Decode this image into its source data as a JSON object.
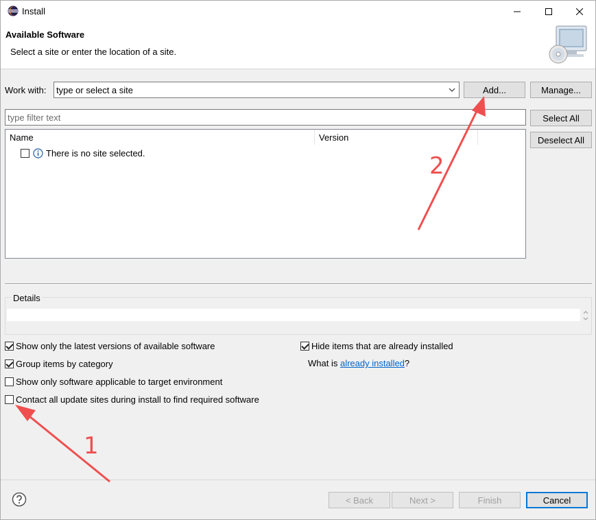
{
  "window": {
    "title": "Install",
    "controls": {
      "minimize_icon": "minimize-icon",
      "maximize_icon": "maximize-icon",
      "close_icon": "close-icon"
    }
  },
  "banner": {
    "title": "Available Software",
    "subtitle": "Select a site or enter the location of a site.",
    "icon": "computer-cd-icon"
  },
  "work_with": {
    "label": "Work with:",
    "value": "type or select a site",
    "add_label": "Add...",
    "manage_label": "Manage..."
  },
  "filter": {
    "placeholder": "type filter text",
    "select_all_label": "Select All",
    "deselect_all_label": "Deselect All"
  },
  "table": {
    "columns": [
      "Name",
      "Version"
    ],
    "rows": [
      {
        "checked": false,
        "icon": "info-icon",
        "text": "There is no site selected."
      }
    ]
  },
  "details": {
    "label": "Details"
  },
  "options": {
    "show_latest": {
      "label": "Show only the latest versions of available software",
      "checked": true
    },
    "group_by_category": {
      "label": "Group items by category",
      "checked": true
    },
    "show_applicable": {
      "label": "Show only software applicable to target environment",
      "checked": false
    },
    "contact_sites": {
      "label": "Contact all update sites during install to find required software",
      "checked": false
    },
    "hide_installed": {
      "label": "Hide items that are already installed",
      "checked": true
    },
    "what_is_prefix": "What is ",
    "what_is_link": "already installed",
    "what_is_suffix": "?"
  },
  "footer": {
    "back_label": "< Back",
    "next_label": "Next >",
    "finish_label": "Finish",
    "cancel_label": "Cancel"
  },
  "annotations": {
    "num1": "1",
    "num2": "2",
    "color": "#ef4f4f"
  }
}
